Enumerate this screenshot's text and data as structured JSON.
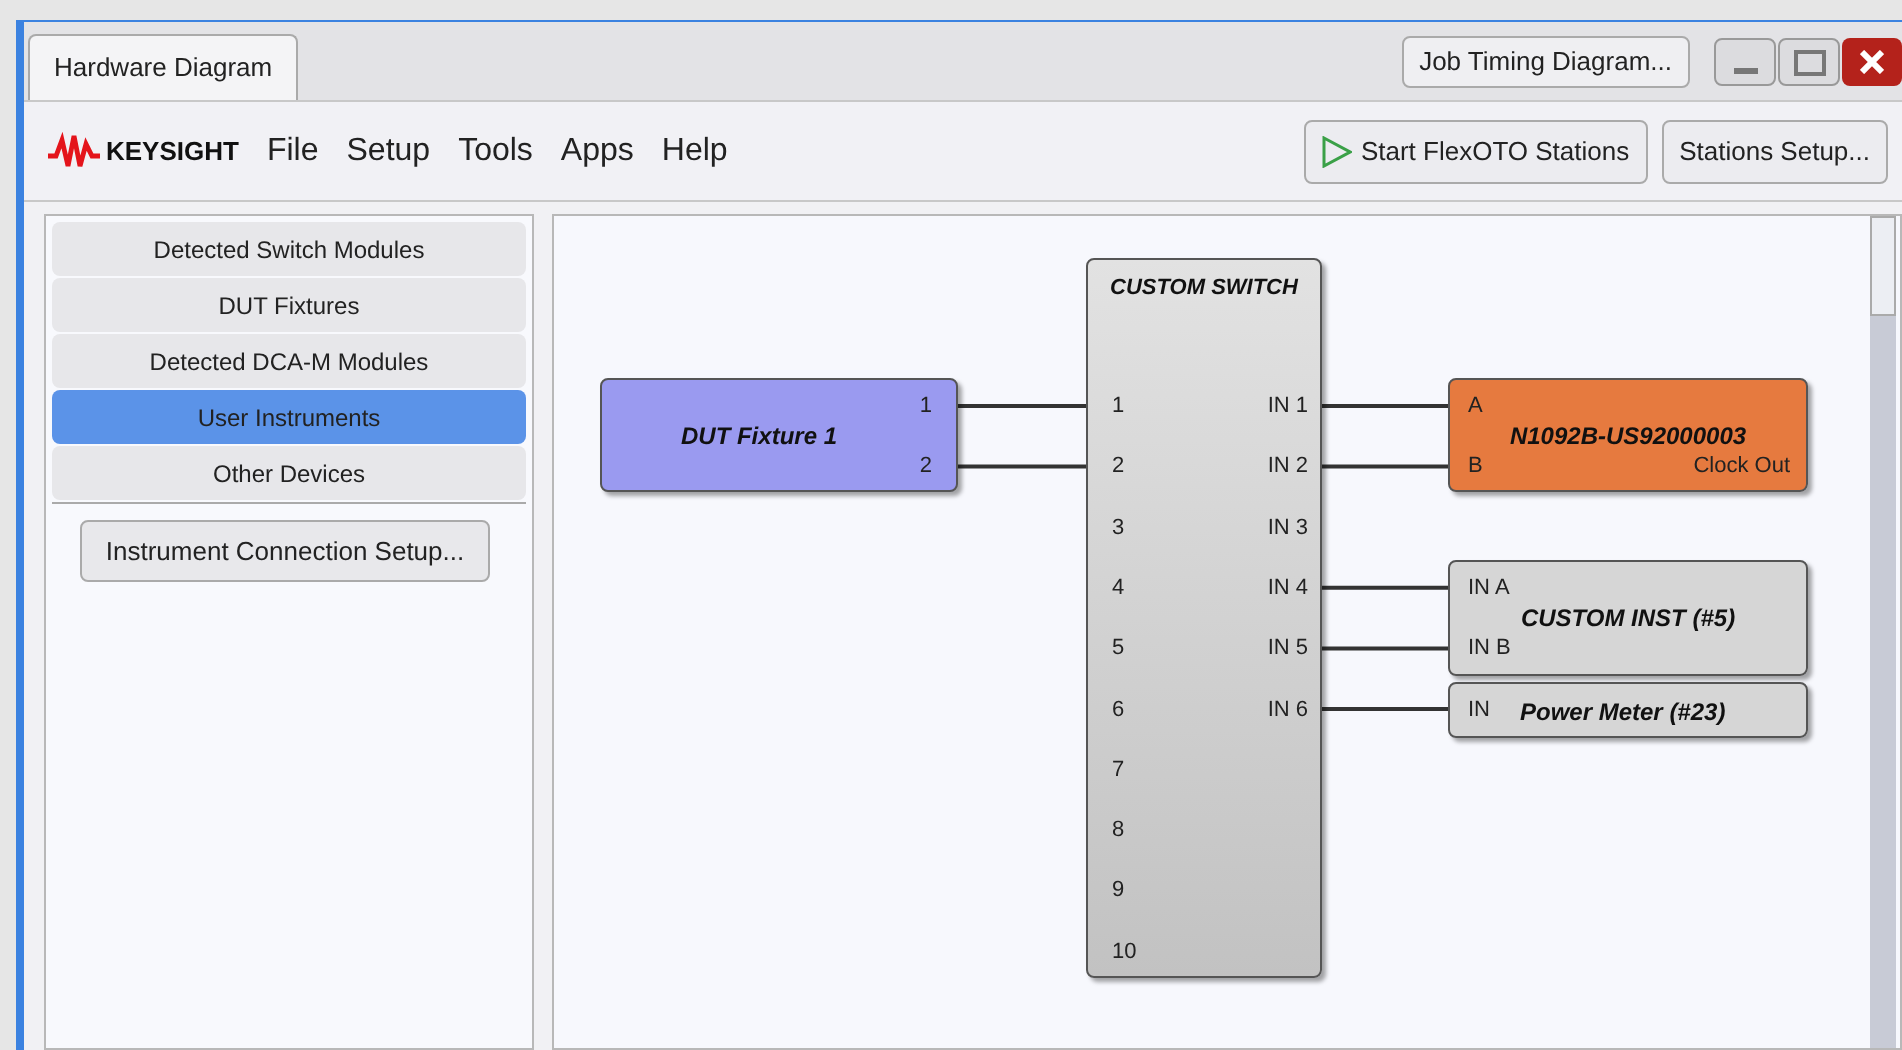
{
  "tabs": [
    {
      "label": "Hardware Diagram",
      "selected": true
    }
  ],
  "header_button": "Job Timing Diagram...",
  "logo": "KEYSIGHT",
  "menu": [
    "File",
    "Setup",
    "Tools",
    "Apps",
    "Help"
  ],
  "toolbar": [
    {
      "label": "Start FlexOTO Stations",
      "kind": "play"
    },
    {
      "label": "Stations Setup...",
      "kind": "plain"
    }
  ],
  "sidebar": {
    "items": [
      {
        "label": "Detected Switch Modules",
        "selected": false
      },
      {
        "label": "DUT Fixtures",
        "selected": false
      },
      {
        "label": "Detected DCA-M Modules",
        "selected": false
      },
      {
        "label": "User Instruments",
        "selected": true
      },
      {
        "label": "Other Devices",
        "selected": false
      }
    ],
    "button": "Instrument Connection Setup..."
  },
  "diagram": {
    "switch": {
      "title": "CUSTOM SWITCH",
      "left_ports": [
        "1",
        "2",
        "3",
        "4",
        "5",
        "6",
        "7",
        "8",
        "9",
        "10"
      ],
      "right_ports": [
        "IN 1",
        "IN 2",
        "IN 3",
        "IN 4",
        "IN 5",
        "IN 6"
      ]
    },
    "dut": {
      "title": "DUT Fixture 1",
      "ports": [
        "1",
        "2"
      ],
      "color": "#9a9af0"
    },
    "instruments": [
      {
        "title": "N1092B-US92000003",
        "ports": [
          "A",
          "B"
        ],
        "output": "Clock Out",
        "color": "#e67a3f"
      },
      {
        "title": "CUSTOM INST (#5)",
        "ports": [
          "IN A",
          "IN B"
        ],
        "color": "#d6d6d6"
      },
      {
        "title": "Power Meter (#23)",
        "ports": [
          "IN"
        ],
        "color": "#d6d6d6"
      }
    ]
  }
}
